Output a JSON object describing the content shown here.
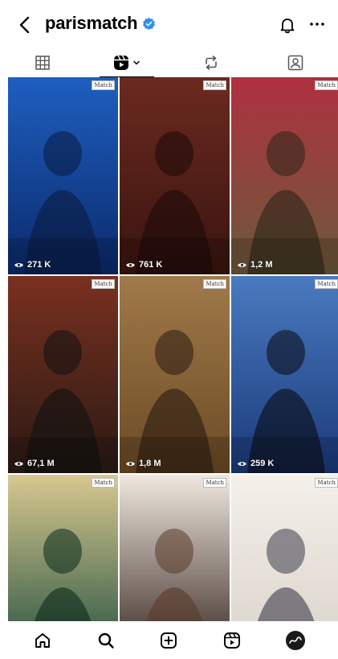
{
  "header": {
    "username": "parismatch"
  },
  "tabs": [
    {
      "name": "grid-icon"
    },
    {
      "name": "reels-icon",
      "active": true
    },
    {
      "name": "reposts-icon"
    },
    {
      "name": "tagged-icon"
    }
  ],
  "grid": {
    "brand_mark": "Match",
    "items": [
      {
        "views": "271 K",
        "colors": [
          "#0b2a6b",
          "#1e5fc0",
          "#0a1a40"
        ]
      },
      {
        "views": "761 K",
        "colors": [
          "#3a1410",
          "#6b2a20",
          "#1c0a08"
        ]
      },
      {
        "views": "1,2 M",
        "colors": [
          "#6b5a3a",
          "#b03040",
          "#2a2418"
        ]
      },
      {
        "views": "67,1 M",
        "colors": [
          "#2a1a14",
          "#7a3020",
          "#101010"
        ]
      },
      {
        "views": "1,8 M",
        "colors": [
          "#6b4a24",
          "#a07a4a",
          "#2a1a10"
        ]
      },
      {
        "views": "259 K",
        "colors": [
          "#1a3a7a",
          "#4a7ac0",
          "#0a0a10"
        ]
      },
      {
        "views": "",
        "colors": [
          "#1a4a3a",
          "#d8c890",
          "#0a2a1a"
        ]
      },
      {
        "views": "",
        "colors": [
          "#2a1a14",
          "#f0e8e0",
          "#5a3a2a"
        ]
      },
      {
        "views": "",
        "colors": [
          "#d8d0c8",
          "#f4f0ea",
          "#3a3a4a"
        ]
      }
    ]
  },
  "bottom_nav": [
    {
      "name": "home-icon"
    },
    {
      "name": "search-icon"
    },
    {
      "name": "create-icon"
    },
    {
      "name": "reels-nav-icon"
    },
    {
      "name": "profile-avatar"
    }
  ]
}
